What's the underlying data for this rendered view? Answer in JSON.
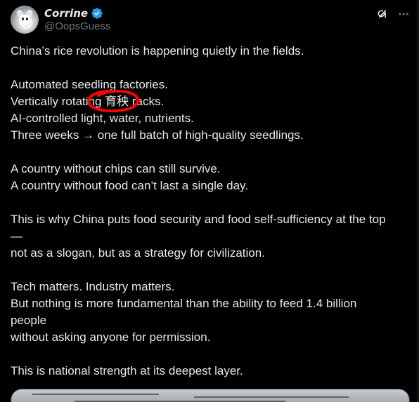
{
  "author": {
    "display_name": "Corrine",
    "handle": "@OopsGuess",
    "verified": true,
    "avatar": "cartoon-cat-avatar"
  },
  "header_actions": [
    {
      "icon": "grok-icon"
    },
    {
      "icon": "more-icon",
      "label": "···"
    }
  ],
  "tweet": {
    "lines": [
      "China’s rice revolution is happening quietly in the fields.",
      "",
      "Automated seedling factories.",
      "Vertically rotating 育秧 racks.",
      "AI-controlled light, water, nutrients.",
      "Three weeks → one full batch of high-quality seedlings.",
      "",
      "A country without chips can still survive.",
      "A country without food can’t last a single day.",
      "",
      "This is why China puts food security and food self-sufficiency at the top",
      "—",
      "not as a slogan, but as a strategy for civilization.",
      "",
      "Tech matters. Industry matters.",
      "But nothing is more fundamental than the ability to feed 1.4 billion",
      "people",
      "without asking anyone for permission.",
      "",
      "This is national strength at its deepest layer."
    ],
    "annotation": {
      "type": "red-hand-drawn-circle",
      "target": "育秧",
      "color": "#ff0000"
    }
  },
  "colors": {
    "background": "#000000",
    "text": "#e7e9ea",
    "secondary_text": "#71767b",
    "verified": "#1d9bf0",
    "border": "#2f3336"
  }
}
